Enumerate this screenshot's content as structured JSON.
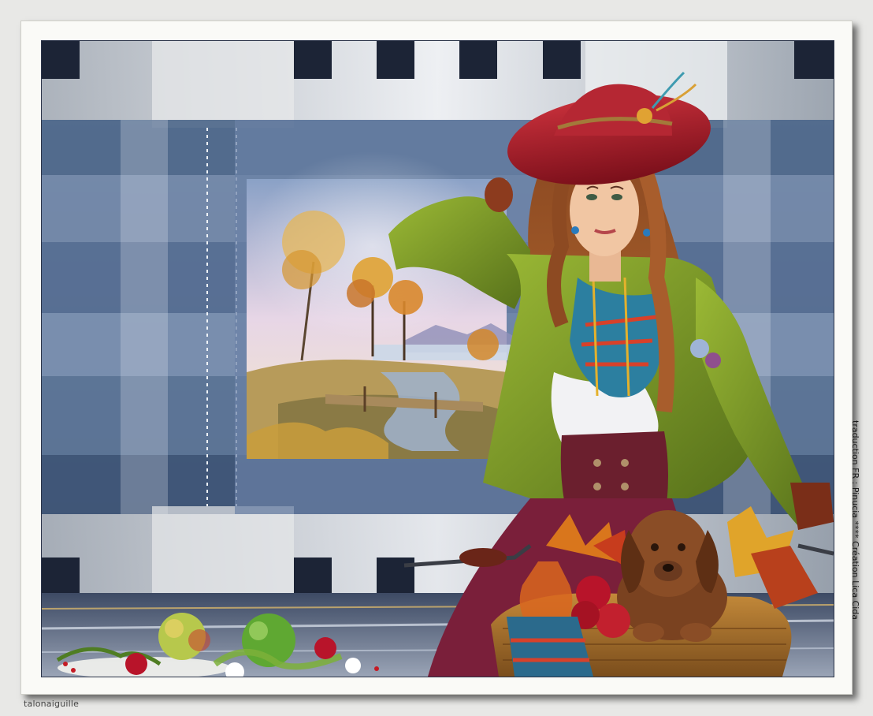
{
  "artwork": {
    "signature": "talonaiguille",
    "credit": "traduction FR : Pinucia **** Création Lica Cida"
  },
  "colors": {
    "frame": "#fafaf7",
    "steel_blue": "#5f7698",
    "dark_navy": "#1c2436",
    "silver": "#cfd3d8",
    "hat_red": "#a51e2a",
    "jacket_green": "#7d9a22",
    "hair_auburn": "#7a3a1c",
    "puppy_brown": "#6b3a1f"
  }
}
